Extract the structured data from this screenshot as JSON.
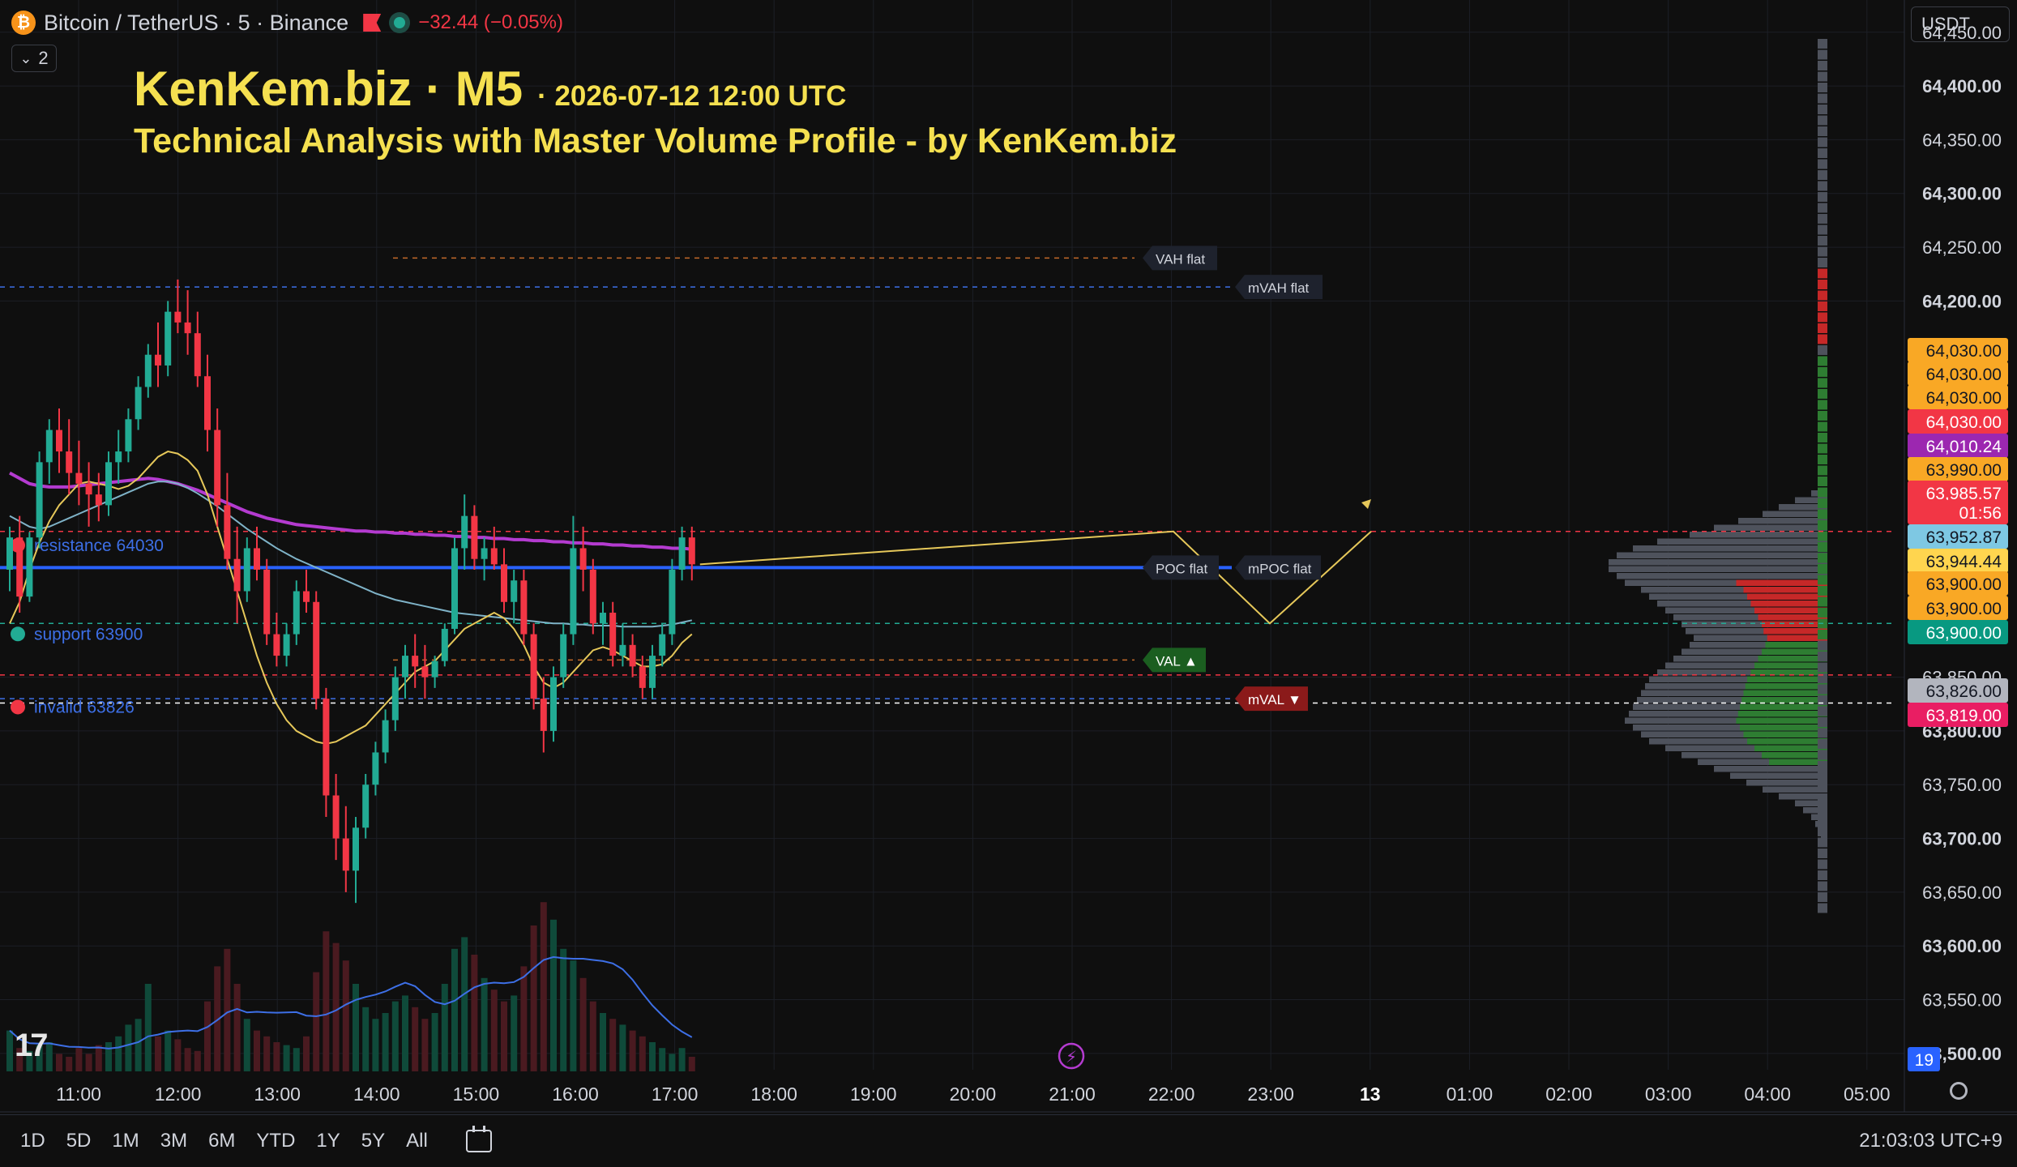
{
  "header": {
    "symbol_text": "Bitcoin / TetherUS · 5 · Binance",
    "change_text": "−32.44 (−0.05%)",
    "collapse_count": "2",
    "currency": "USDT"
  },
  "overlay": {
    "title_main": "KenKem.biz · M5",
    "title_time": "· 2026-07-12 12:00 UTC",
    "subtitle": "Technical Analysis with Master Volume Profile - by KenKem.biz"
  },
  "price_axis": {
    "ticks": [
      "64,450.00",
      "64,400.00",
      "64,350.00",
      "64,300.00",
      "64,250.00",
      "64,200.00",
      "63,850.00",
      "63,800.00",
      "63,750.00",
      "63,700.00",
      "63,650.00",
      "63,600.00",
      "63,550.00",
      "63,500.00"
    ],
    "bold_ticks": [
      "64,400.00",
      "64,300.00",
      "64,200.00",
      "63,800.00",
      "63,700.00",
      "63,600.00",
      "63,500.00"
    ],
    "labels": [
      {
        "text": "64,030.00",
        "bg": "#f9a825",
        "fg": "#131722"
      },
      {
        "text": "64,030.00",
        "bg": "#f9a825",
        "fg": "#131722"
      },
      {
        "text": "64,030.00",
        "bg": "#f9a825",
        "fg": "#131722"
      },
      {
        "text": "64,030.00",
        "bg": "#f23645",
        "fg": "#ffffff"
      },
      {
        "text": "64,010.24",
        "bg": "#9c27b0",
        "fg": "#ffffff"
      },
      {
        "text": "63,990.00",
        "bg": "#f9a825",
        "fg": "#131722"
      },
      {
        "text": "63,985.57",
        "bg": "#f23645",
        "fg": "#ffffff"
      },
      {
        "text": "01:56",
        "bg": "#f23645",
        "fg": "#ffffff"
      },
      {
        "text": "63,952.87",
        "bg": "#7ec8e3",
        "fg": "#131722"
      },
      {
        "text": "63,944.44",
        "bg": "#ffd54f",
        "fg": "#131722"
      },
      {
        "text": "63,900.00",
        "bg": "#f9a825",
        "fg": "#131722"
      },
      {
        "text": "63,900.00",
        "bg": "#f9a825",
        "fg": "#131722"
      },
      {
        "text": "63,900.00",
        "bg": "#089981",
        "fg": "#ffffff"
      },
      {
        "text": "63,826.00",
        "bg": "#b2b5be",
        "fg": "#131722"
      },
      {
        "text": "63,819.00",
        "bg": "#e91e63",
        "fg": "#ffffff"
      },
      {
        "text": "19",
        "bg": "#2962ff",
        "fg": "#ffffff"
      }
    ]
  },
  "time_axis": [
    "11:00",
    "12:00",
    "13:00",
    "14:00",
    "15:00",
    "16:00",
    "17:00",
    "18:00",
    "19:00",
    "20:00",
    "21:00",
    "22:00",
    "23:00",
    "13",
    "01:00",
    "02:00",
    "03:00",
    "04:00",
    "05:00"
  ],
  "chart_lines": [
    {
      "text": "resistance 64030",
      "color": "#f23645"
    },
    {
      "text": "support 63900",
      "color": "#22ab94"
    },
    {
      "text": "invalid 63826",
      "color": "#f23645"
    }
  ],
  "profile_tags": [
    "VAH flat",
    "mVAH flat",
    "POC flat",
    "mPOC flat",
    "VAL ▲",
    "mVAL ▼"
  ],
  "colors": {
    "up": "#22ab94",
    "down": "#f23645",
    "poc": "#2962ff",
    "ema_long": "#b43bd0",
    "ema_mid": "#7fb3c8",
    "ema_short": "#e6c85a"
  },
  "range_buttons": [
    "1D",
    "5D",
    "1M",
    "3M",
    "6M",
    "YTD",
    "1Y",
    "5Y",
    "All"
  ],
  "clock": "21:03:03 UTC+9",
  "chart_data": {
    "type": "candlestick",
    "symbol": "Bitcoin / TetherUS",
    "interval": "5",
    "ylim": [
      63475,
      64480
    ],
    "levels": {
      "resistance": 64030,
      "support": 63900,
      "invalid": 63826,
      "last": 63985.57
    },
    "series": [
      {
        "name": "price",
        "values": [
          [
            63950,
            63990,
            63930,
            63980
          ],
          [
            63980,
            64000,
            63910,
            63925
          ],
          [
            63925,
            63985,
            63920,
            63980
          ],
          [
            63980,
            64060,
            63970,
            64050
          ],
          [
            64050,
            64090,
            64030,
            64080
          ],
          [
            64080,
            64100,
            64040,
            64060
          ],
          [
            64060,
            64090,
            64020,
            64040
          ],
          [
            64040,
            64070,
            64010,
            64030
          ],
          [
            64030,
            64050,
            63990,
            64020
          ],
          [
            64020,
            64040,
            63995,
            64010
          ],
          [
            64010,
            64060,
            64000,
            64050
          ],
          [
            64050,
            64080,
            64030,
            64060
          ],
          [
            64060,
            64100,
            64050,
            64090
          ],
          [
            64090,
            64130,
            64080,
            64120
          ],
          [
            64120,
            64160,
            64110,
            64150
          ],
          [
            64150,
            64180,
            64120,
            64140
          ],
          [
            64140,
            64200,
            64130,
            64190
          ],
          [
            64190,
            64220,
            64170,
            64180
          ],
          [
            64180,
            64210,
            64150,
            64170
          ],
          [
            64170,
            64190,
            64120,
            64130
          ],
          [
            64130,
            64150,
            64060,
            64080
          ],
          [
            64080,
            64100,
            63990,
            64010
          ],
          [
            64010,
            64040,
            63950,
            63960
          ],
          [
            63960,
            63990,
            63900,
            63930
          ],
          [
            63930,
            63980,
            63920,
            63970
          ],
          [
            63970,
            63990,
            63940,
            63950
          ],
          [
            63950,
            63960,
            63880,
            63890
          ],
          [
            63890,
            63910,
            63860,
            63870
          ],
          [
            63870,
            63900,
            63860,
            63890
          ],
          [
            63890,
            63940,
            63880,
            63930
          ],
          [
            63930,
            63950,
            63910,
            63920
          ],
          [
            63920,
            63930,
            63820,
            63830
          ],
          [
            63830,
            63840,
            63720,
            63740
          ],
          [
            63740,
            63760,
            63680,
            63700
          ],
          [
            63700,
            63730,
            63650,
            63670
          ],
          [
            63670,
            63720,
            63640,
            63710
          ],
          [
            63710,
            63760,
            63700,
            63750
          ],
          [
            63750,
            63790,
            63740,
            63780
          ],
          [
            63780,
            63820,
            63770,
            63810
          ],
          [
            63810,
            63860,
            63800,
            63850
          ],
          [
            63850,
            63880,
            63830,
            63870
          ],
          [
            63870,
            63890,
            63840,
            63860
          ],
          [
            63860,
            63880,
            63830,
            63850
          ],
          [
            63850,
            63870,
            63840,
            63865
          ],
          [
            63865,
            63900,
            63860,
            63895
          ],
          [
            63895,
            63980,
            63890,
            63970
          ],
          [
            63970,
            64020,
            63950,
            64000
          ],
          [
            64000,
            64010,
            63950,
            63960
          ],
          [
            63960,
            63980,
            63940,
            63970
          ],
          [
            63970,
            63990,
            63950,
            63955
          ],
          [
            63955,
            63970,
            63910,
            63920
          ],
          [
            63920,
            63950,
            63900,
            63940
          ],
          [
            63940,
            63950,
            63880,
            63890
          ],
          [
            63890,
            63900,
            63820,
            63830
          ],
          [
            63830,
            63850,
            63780,
            63800
          ],
          [
            63800,
            63860,
            63790,
            63850
          ],
          [
            63850,
            63900,
            63840,
            63890
          ],
          [
            63890,
            64000,
            63880,
            63970
          ],
          [
            63970,
            63990,
            63930,
            63950
          ],
          [
            63950,
            63960,
            63890,
            63900
          ],
          [
            63900,
            63920,
            63880,
            63910
          ],
          [
            63910,
            63920,
            63860,
            63870
          ],
          [
            63870,
            63900,
            63860,
            63880
          ],
          [
            63880,
            63890,
            63850,
            63860
          ],
          [
            63860,
            63870,
            63830,
            63840
          ],
          [
            63840,
            63880,
            63830,
            63870
          ],
          [
            63870,
            63900,
            63860,
            63890
          ],
          [
            63890,
            63960,
            63880,
            63950
          ],
          [
            63950,
            63990,
            63940,
            63980
          ],
          [
            63980,
            63990,
            63940,
            63955
          ]
        ]
      },
      {
        "name": "volume",
        "values": [
          70,
          40,
          35,
          45,
          50,
          30,
          25,
          40,
          30,
          45,
          50,
          60,
          80,
          90,
          150,
          60,
          70,
          55,
          40,
          35,
          120,
          180,
          210,
          150,
          90,
          70,
          60,
          50,
          45,
          40,
          60,
          170,
          240,
          220,
          190,
          150,
          110,
          90,
          100,
          120,
          130,
          110,
          90,
          100,
          150,
          210,
          230,
          200,
          160,
          140,
          120,
          130,
          180,
          250,
          290,
          260,
          210,
          190,
          160,
          120,
          100,
          90,
          80,
          70,
          60,
          50,
          40,
          30,
          40,
          25
        ]
      },
      {
        "name": "ema_long",
        "values": [
          64040,
          64035,
          64030,
          64028,
          64027,
          64027,
          64027,
          64028,
          64029,
          64030,
          64031,
          64032,
          64033,
          64034,
          64035,
          64034,
          64032,
          64030,
          64027,
          64024,
          64020,
          64016,
          64012,
          64008,
          64004,
          64001,
          63998,
          63996,
          63994,
          63992,
          63991,
          63990,
          63989,
          63988,
          63987,
          63986,
          63986,
          63985,
          63985,
          63984,
          63984,
          63983,
          63983,
          63982,
          63982,
          63981,
          63981,
          63980,
          63980,
          63979,
          63979,
          63978,
          63978,
          63977,
          63977,
          63976,
          63976,
          63975,
          63975,
          63974,
          63974,
          63973,
          63973,
          63972,
          63972,
          63971,
          63971,
          63970,
          63970,
          63969
        ]
      },
      {
        "name": "ema_mid",
        "values": [
          64000,
          63995,
          63990,
          63988,
          63990,
          63994,
          63998,
          64002,
          64006,
          64010,
          64014,
          64018,
          64022,
          64026,
          64030,
          64032,
          64032,
          64030,
          64026,
          64021,
          64015,
          64009,
          64002,
          63995,
          63988,
          63982,
          63976,
          63970,
          63965,
          63960,
          63956,
          63952,
          63948,
          63944,
          63940,
          63936,
          63932,
          63928,
          63925,
          63922,
          63920,
          63918,
          63916,
          63914,
          63912,
          63910,
          63909,
          63908,
          63907,
          63906,
          63905,
          63904,
          63903,
          63902,
          63901,
          63900,
          63900,
          63899,
          63899,
          63898,
          63898,
          63898,
          63897,
          63897,
          63897,
          63897,
          63898,
          63899,
          63901,
          63903
        ]
      },
      {
        "name": "ema_short",
        "values": [
          63900,
          63920,
          63950,
          63975,
          63995,
          64010,
          64020,
          64030,
          64032,
          64030,
          64028,
          64025,
          64028,
          64035,
          64045,
          64055,
          64060,
          64058,
          64052,
          64042,
          64020,
          63990,
          63960,
          63930,
          63900,
          63870,
          63845,
          63825,
          63810,
          63800,
          63795,
          63790,
          63788,
          63790,
          63795,
          63800,
          63805,
          63815,
          63825,
          63835,
          63845,
          63855,
          63860,
          63865,
          63875,
          63885,
          63895,
          63900,
          63905,
          63910,
          63905,
          63895,
          63880,
          63860,
          63845,
          63840,
          63845,
          63855,
          63865,
          63875,
          63878,
          63875,
          63870,
          63865,
          63860,
          63860,
          63862,
          63870,
          63882,
          63890
        ]
      }
    ]
  }
}
